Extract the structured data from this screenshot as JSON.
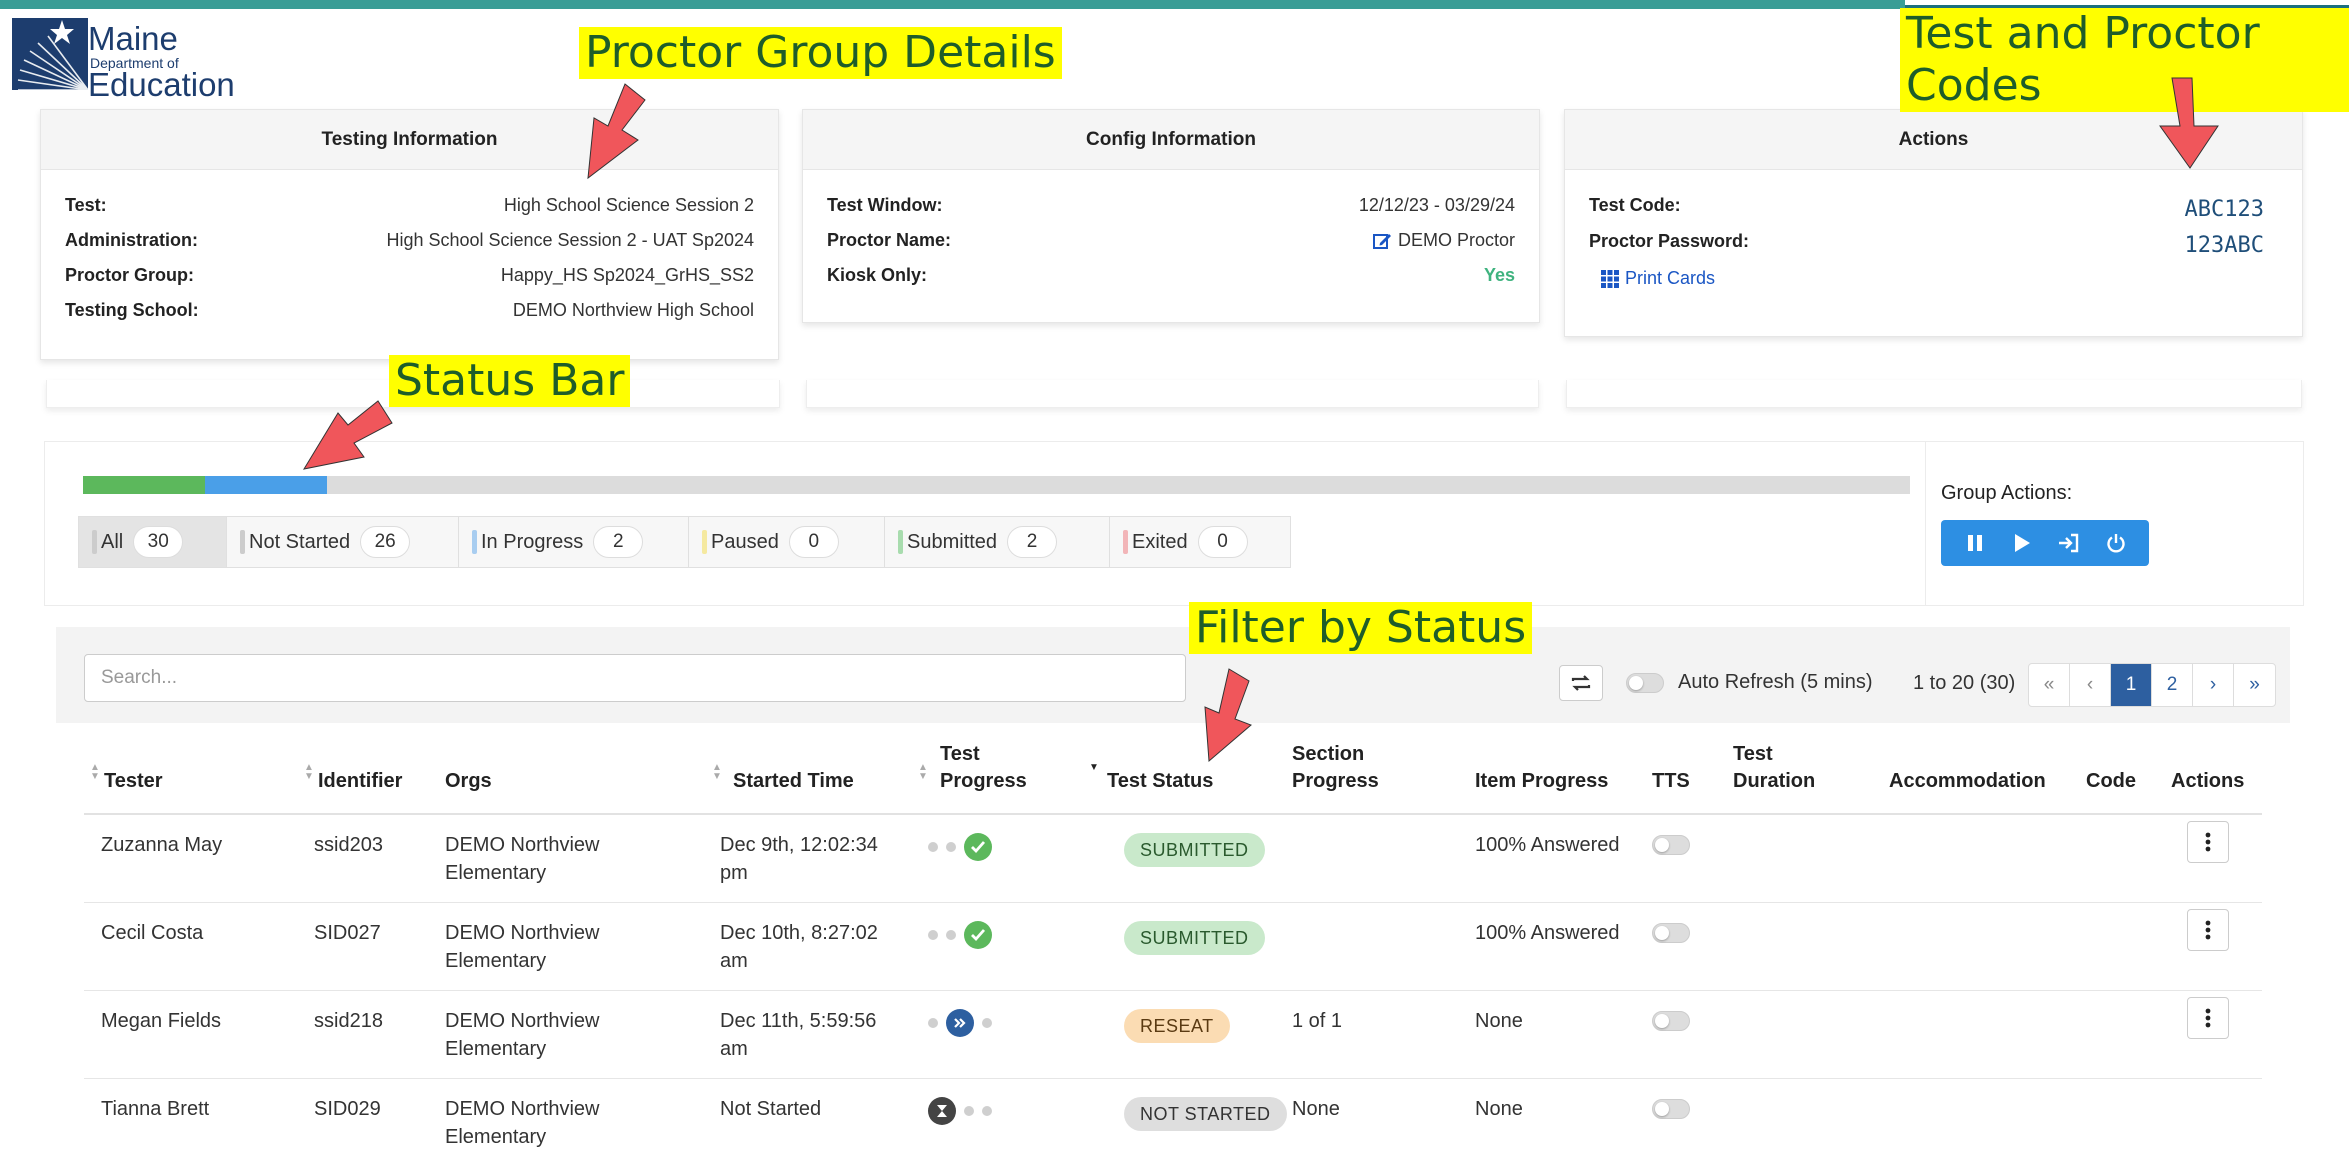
{
  "colors": {
    "brand_teal": "#3a9d96",
    "primary_blue": "#2d8fe3",
    "pager_blue": "#2d5fa0",
    "submitted_green": "#5cb85c",
    "in_progress_blue": "#4a9fe8",
    "callout_yellow": "#ffff00",
    "callout_text": "#1e5d2a",
    "arrow_red": "#f0565b"
  },
  "logo": {
    "line1": "Maine",
    "line2": "Department of",
    "line3": "Education"
  },
  "testing_info": {
    "title": "Testing Information",
    "rows": [
      {
        "label": "Test:",
        "value": "High School Science Session 2"
      },
      {
        "label": "Administration:",
        "value": "High School Science Session 2 - UAT Sp2024"
      },
      {
        "label": "Proctor Group:",
        "value": "Happy_HS Sp2024_GrHS_SS2"
      },
      {
        "label": "Testing School:",
        "value": "DEMO Northview High School"
      }
    ]
  },
  "config_info": {
    "title": "Config Information",
    "test_window_label": "Test Window:",
    "test_window_value": "12/12/23 - 03/29/24",
    "proctor_name_label": "Proctor Name:",
    "proctor_name_value": "DEMO Proctor",
    "kiosk_label": "Kiosk Only:",
    "kiosk_value": "Yes"
  },
  "actions_card": {
    "title": "Actions",
    "test_code_label": "Test Code:",
    "test_code_value": "ABC123",
    "proctor_password_label": "Proctor Password:",
    "proctor_password_value": "123ABC",
    "print_cards_label": "Print Cards"
  },
  "status_bar": {
    "total": 30,
    "filters": [
      {
        "label": "All",
        "count": "30",
        "color": "#cccccc",
        "active": true
      },
      {
        "label": "Not Started",
        "count": "26",
        "color": "#cccccc"
      },
      {
        "label": "In Progress",
        "count": "2",
        "color": "#a8cdf0"
      },
      {
        "label": "Paused",
        "count": "0",
        "color": "#f5e9a0"
      },
      {
        "label": "Submitted",
        "count": "2",
        "color": "#a8dcae"
      },
      {
        "label": "Exited",
        "count": "0",
        "color": "#f2b5b8"
      }
    ],
    "group_actions_label": "Group Actions:",
    "group_action_buttons": [
      "pause-icon",
      "play-icon",
      "sign-in-icon",
      "power-icon"
    ]
  },
  "toolbar": {
    "search_placeholder": "Search...",
    "auto_refresh_label": "Auto Refresh (5 mins)",
    "range_text": "1 to 20 (30)",
    "pager": [
      "«",
      "‹",
      "1",
      "2",
      "›",
      "»"
    ],
    "current_page": "1"
  },
  "table": {
    "columns": {
      "tester": "Tester",
      "identifier": "Identifier",
      "orgs": "Orgs",
      "started_time": "Started Time",
      "test_progress_1": "Test",
      "test_progress_2": "Progress",
      "test_status": "Test Status",
      "section_progress_1": "Section",
      "section_progress_2": "Progress",
      "item_progress": "Item Progress",
      "tts": "TTS",
      "test_duration_1": "Test",
      "test_duration_2": "Duration",
      "accommodation": "Accommodation",
      "code": "Code",
      "actions": "Actions"
    },
    "rows": [
      {
        "tester": "Zuzanna May",
        "identifier": "ssid203",
        "orgs_1": "DEMO Northview",
        "orgs_2": "Elementary",
        "started_1": "Dec 9th, 12:02:34",
        "started_2": "pm",
        "progress": "submitted",
        "status": "SUBMITTED",
        "section": "",
        "item": "100% Answered"
      },
      {
        "tester": "Cecil Costa",
        "identifier": "SID027",
        "orgs_1": "DEMO Northview",
        "orgs_2": "Elementary",
        "started_1": "Dec 10th, 8:27:02",
        "started_2": "am",
        "progress": "submitted",
        "status": "SUBMITTED",
        "section": "",
        "item": "100% Answered"
      },
      {
        "tester": "Megan Fields",
        "identifier": "ssid218",
        "orgs_1": "DEMO Northview",
        "orgs_2": "Elementary",
        "started_1": "Dec 11th, 5:59:56",
        "started_2": "am",
        "progress": "in-progress",
        "status": "RESEAT",
        "section": "1 of 1",
        "item": "None"
      },
      {
        "tester": "Tianna Brett",
        "identifier": "SID029",
        "orgs_1": "DEMO Northview",
        "orgs_2": "Elementary",
        "started_1": "Not Started",
        "started_2": "",
        "progress": "not-started",
        "status": "NOT STARTED",
        "section": "None",
        "item": "None"
      }
    ]
  },
  "callouts": {
    "proctor_group": "Proctor Group Details",
    "codes": "Test and Proctor Codes",
    "status_bar": "Status Bar",
    "filter": "Filter by Status"
  }
}
